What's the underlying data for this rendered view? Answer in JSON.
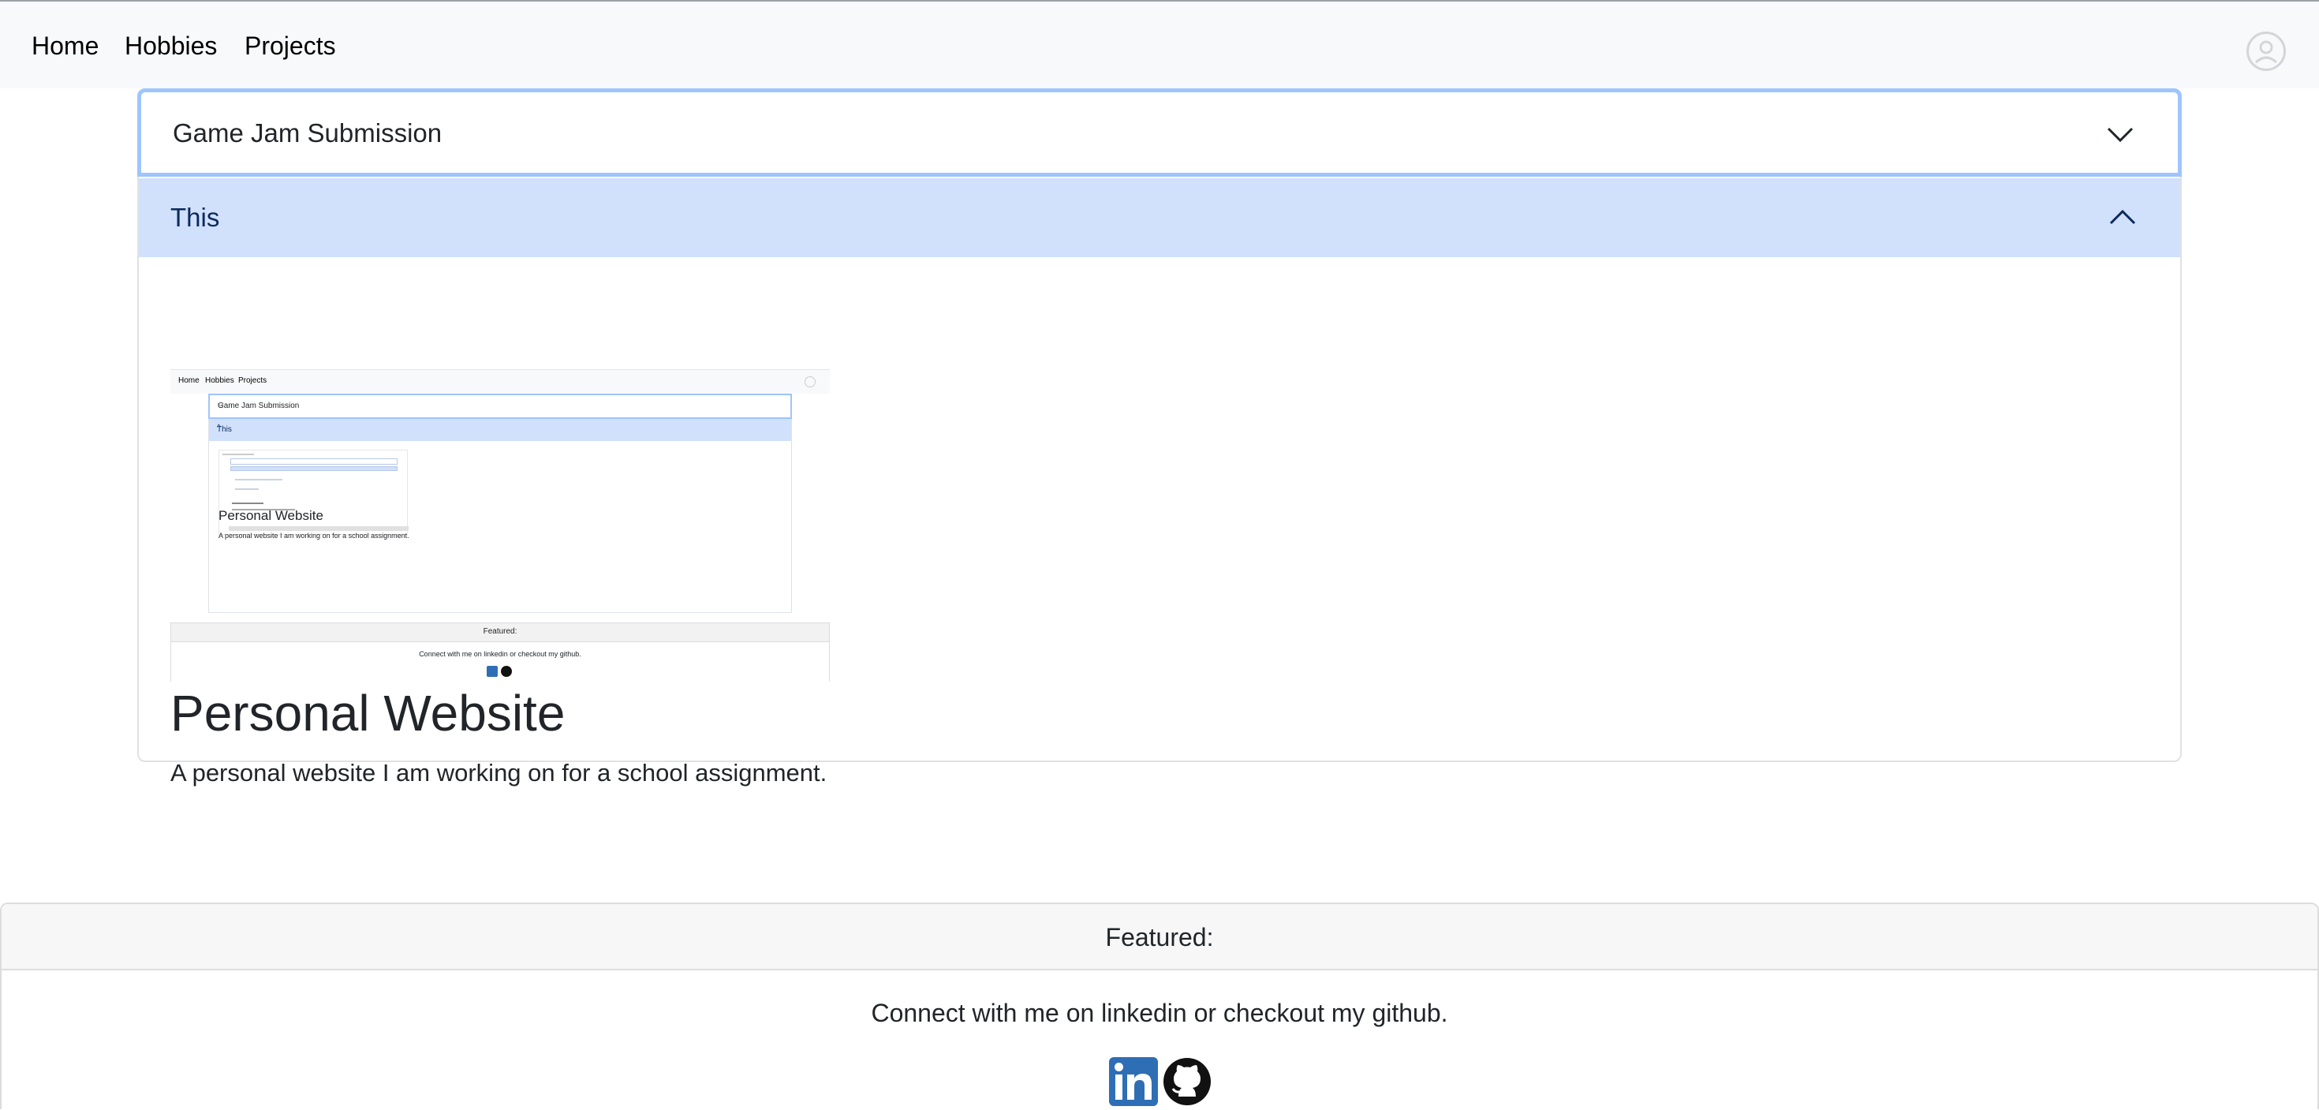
{
  "nav": {
    "home": "Home",
    "hobbies": "Hobbies",
    "projects": "Projects"
  },
  "accordion": {
    "items": [
      {
        "title": "Game Jam Submission",
        "expanded": false
      },
      {
        "title": "This",
        "expanded": true
      }
    ],
    "project": {
      "title": "Personal Website",
      "description": "A personal website I am working on for a school assignment."
    }
  },
  "thumbnail": {
    "nav": [
      "Home",
      "Hobbies",
      "Projects"
    ],
    "item1": "Game Jam Submission",
    "item2": "This",
    "title": "Personal Website",
    "description": "A personal website I am working on for a school assignment.",
    "footer_heading": "Featured:",
    "footer_text": "Connect with me on linkedin or checkout my github."
  },
  "footer": {
    "heading": "Featured:",
    "text": "Connect with me on linkedin or checkout my github."
  },
  "colors": {
    "nav_bg": "#f8f9fa",
    "accordion_active_bg": "#d1e0fb",
    "focus_ring": "#9ec5fe",
    "linkedin": "#2e6eb5",
    "github": "#111111"
  },
  "icons": [
    "profile-icon",
    "chevron-down-icon",
    "chevron-up-icon",
    "linkedin-icon",
    "github-icon"
  ]
}
